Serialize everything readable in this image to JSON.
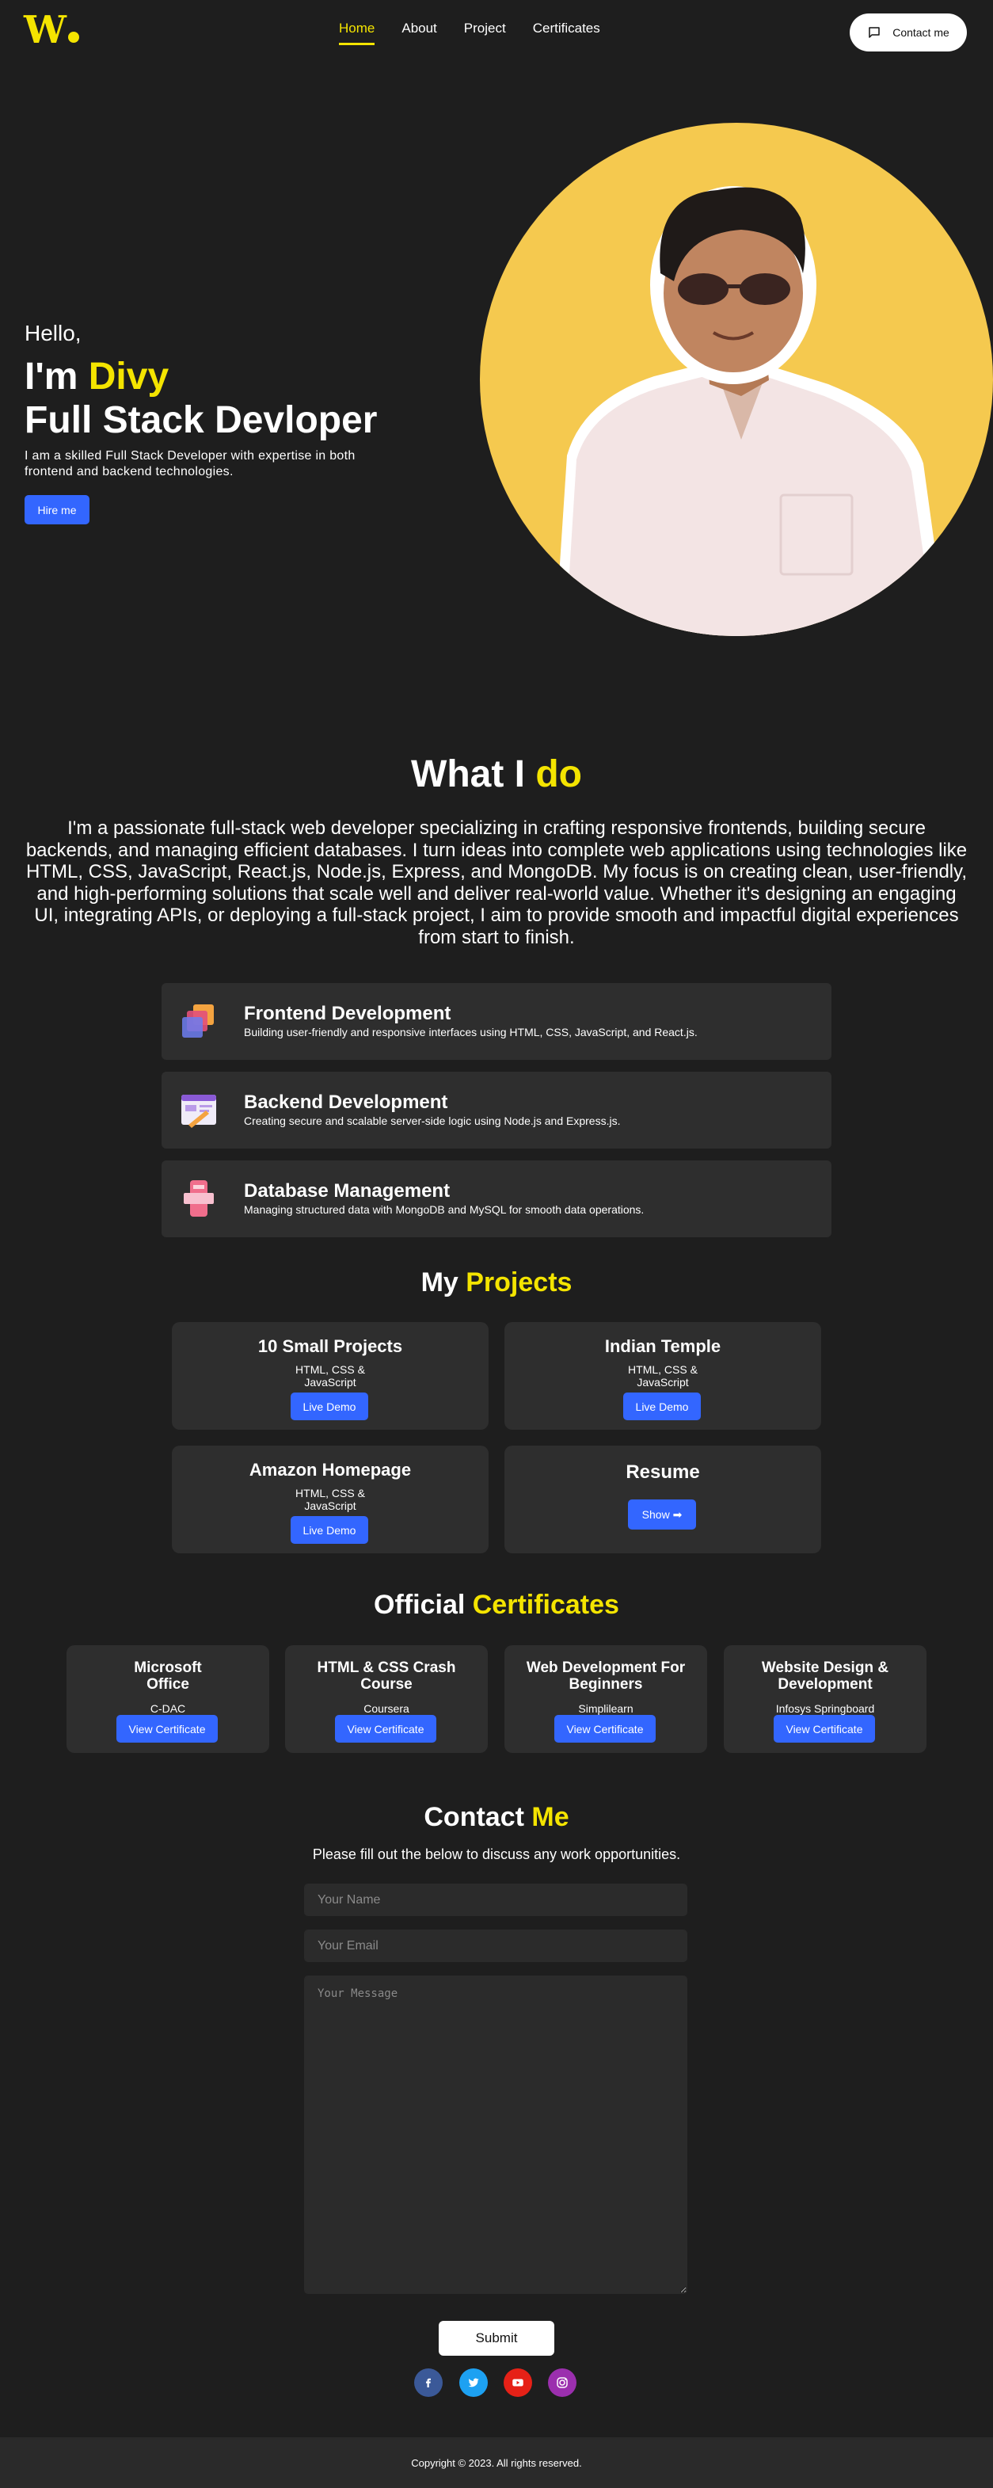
{
  "header": {
    "logo": "W",
    "nav": [
      "Home",
      "About",
      "Project",
      "Certificates"
    ],
    "active_nav": "Home",
    "contact_label": "Contact me"
  },
  "hero": {
    "greeting": "Hello,",
    "im_prefix": "I'm ",
    "name": "Divy",
    "role": "Full Stack Devloper",
    "intro": "I am a skilled Full Stack Developer with expertise in both frontend and backend technologies.",
    "hire_label": "Hire me"
  },
  "whatido": {
    "title_a": "What I ",
    "title_b": "do",
    "bio": "I'm a passionate full-stack web developer specializing in crafting responsive frontends, building secure backends, and managing efficient databases. I turn ideas into complete web applications using technologies like HTML, CSS, JavaScript, React.js, Node.js, Express, and MongoDB. My focus is on creating clean, user-friendly, and high-performing solutions that scale well and deliver real-world value. Whether it's designing an engaging UI, integrating APIs, or deploying a full-stack project, I aim to provide smooth and impactful digital experiences from start to finish.",
    "services": [
      {
        "title": "Frontend Development",
        "desc": "Building user-friendly and responsive interfaces using HTML, CSS, JavaScript, and React.js."
      },
      {
        "title": "Backend Development",
        "desc": "Creating secure and scalable server-side logic using Node.js and Express.js."
      },
      {
        "title": "Database Management",
        "desc": "Managing structured data with MongoDB and MySQL for smooth data operations."
      }
    ]
  },
  "projects": {
    "title_a": "My ",
    "title_b": "Projects",
    "items": [
      {
        "title": "10 Small Projects",
        "tech_1": "HTML, CSS &",
        "tech_2": "JavaScript",
        "button": "Live Demo"
      },
      {
        "title": "Indian Temple",
        "tech_1": "HTML, CSS &",
        "tech_2": "JavaScript",
        "button": "Live Demo"
      },
      {
        "title": "Amazon Homepage",
        "tech_1": "HTML, CSS &",
        "tech_2": "JavaScript",
        "button": "Live Demo"
      },
      {
        "title": "Resume",
        "button": "Show ➡"
      }
    ]
  },
  "certificates": {
    "title_a": "Official ",
    "title_b": "Certificates",
    "items": [
      {
        "title": "Microsoft Office",
        "org": "C-DAC",
        "button": "View Certificate"
      },
      {
        "title": "HTML & CSS Crash Course",
        "org": "Coursera",
        "button": "View Certificate"
      },
      {
        "title": "Web Development For Beginners",
        "org": "Simplilearn",
        "button": "View Certificate"
      },
      {
        "title": "Website Design & Development",
        "org": "Infosys Springboard",
        "button": "View Certificate"
      }
    ]
  },
  "contact": {
    "title_a": "Contact ",
    "title_b": "Me",
    "subtitle": "Please fill out the below to discuss any work opportunities.",
    "name_placeholder": "Your Name",
    "email_placeholder": "Your Email",
    "message_placeholder": "Your Message",
    "submit_label": "Submit",
    "social": [
      "facebook-icon",
      "twitter-icon",
      "youtube-icon",
      "instagram-icon"
    ]
  },
  "footer": {
    "copyright": "Copyright © 2023. All rights reserved."
  },
  "colors": {
    "accent": "#f4e400",
    "button": "#3366ff",
    "background": "#1e1e1e",
    "card": "#2e2e2e",
    "hero_circle": "#f5c94f"
  }
}
